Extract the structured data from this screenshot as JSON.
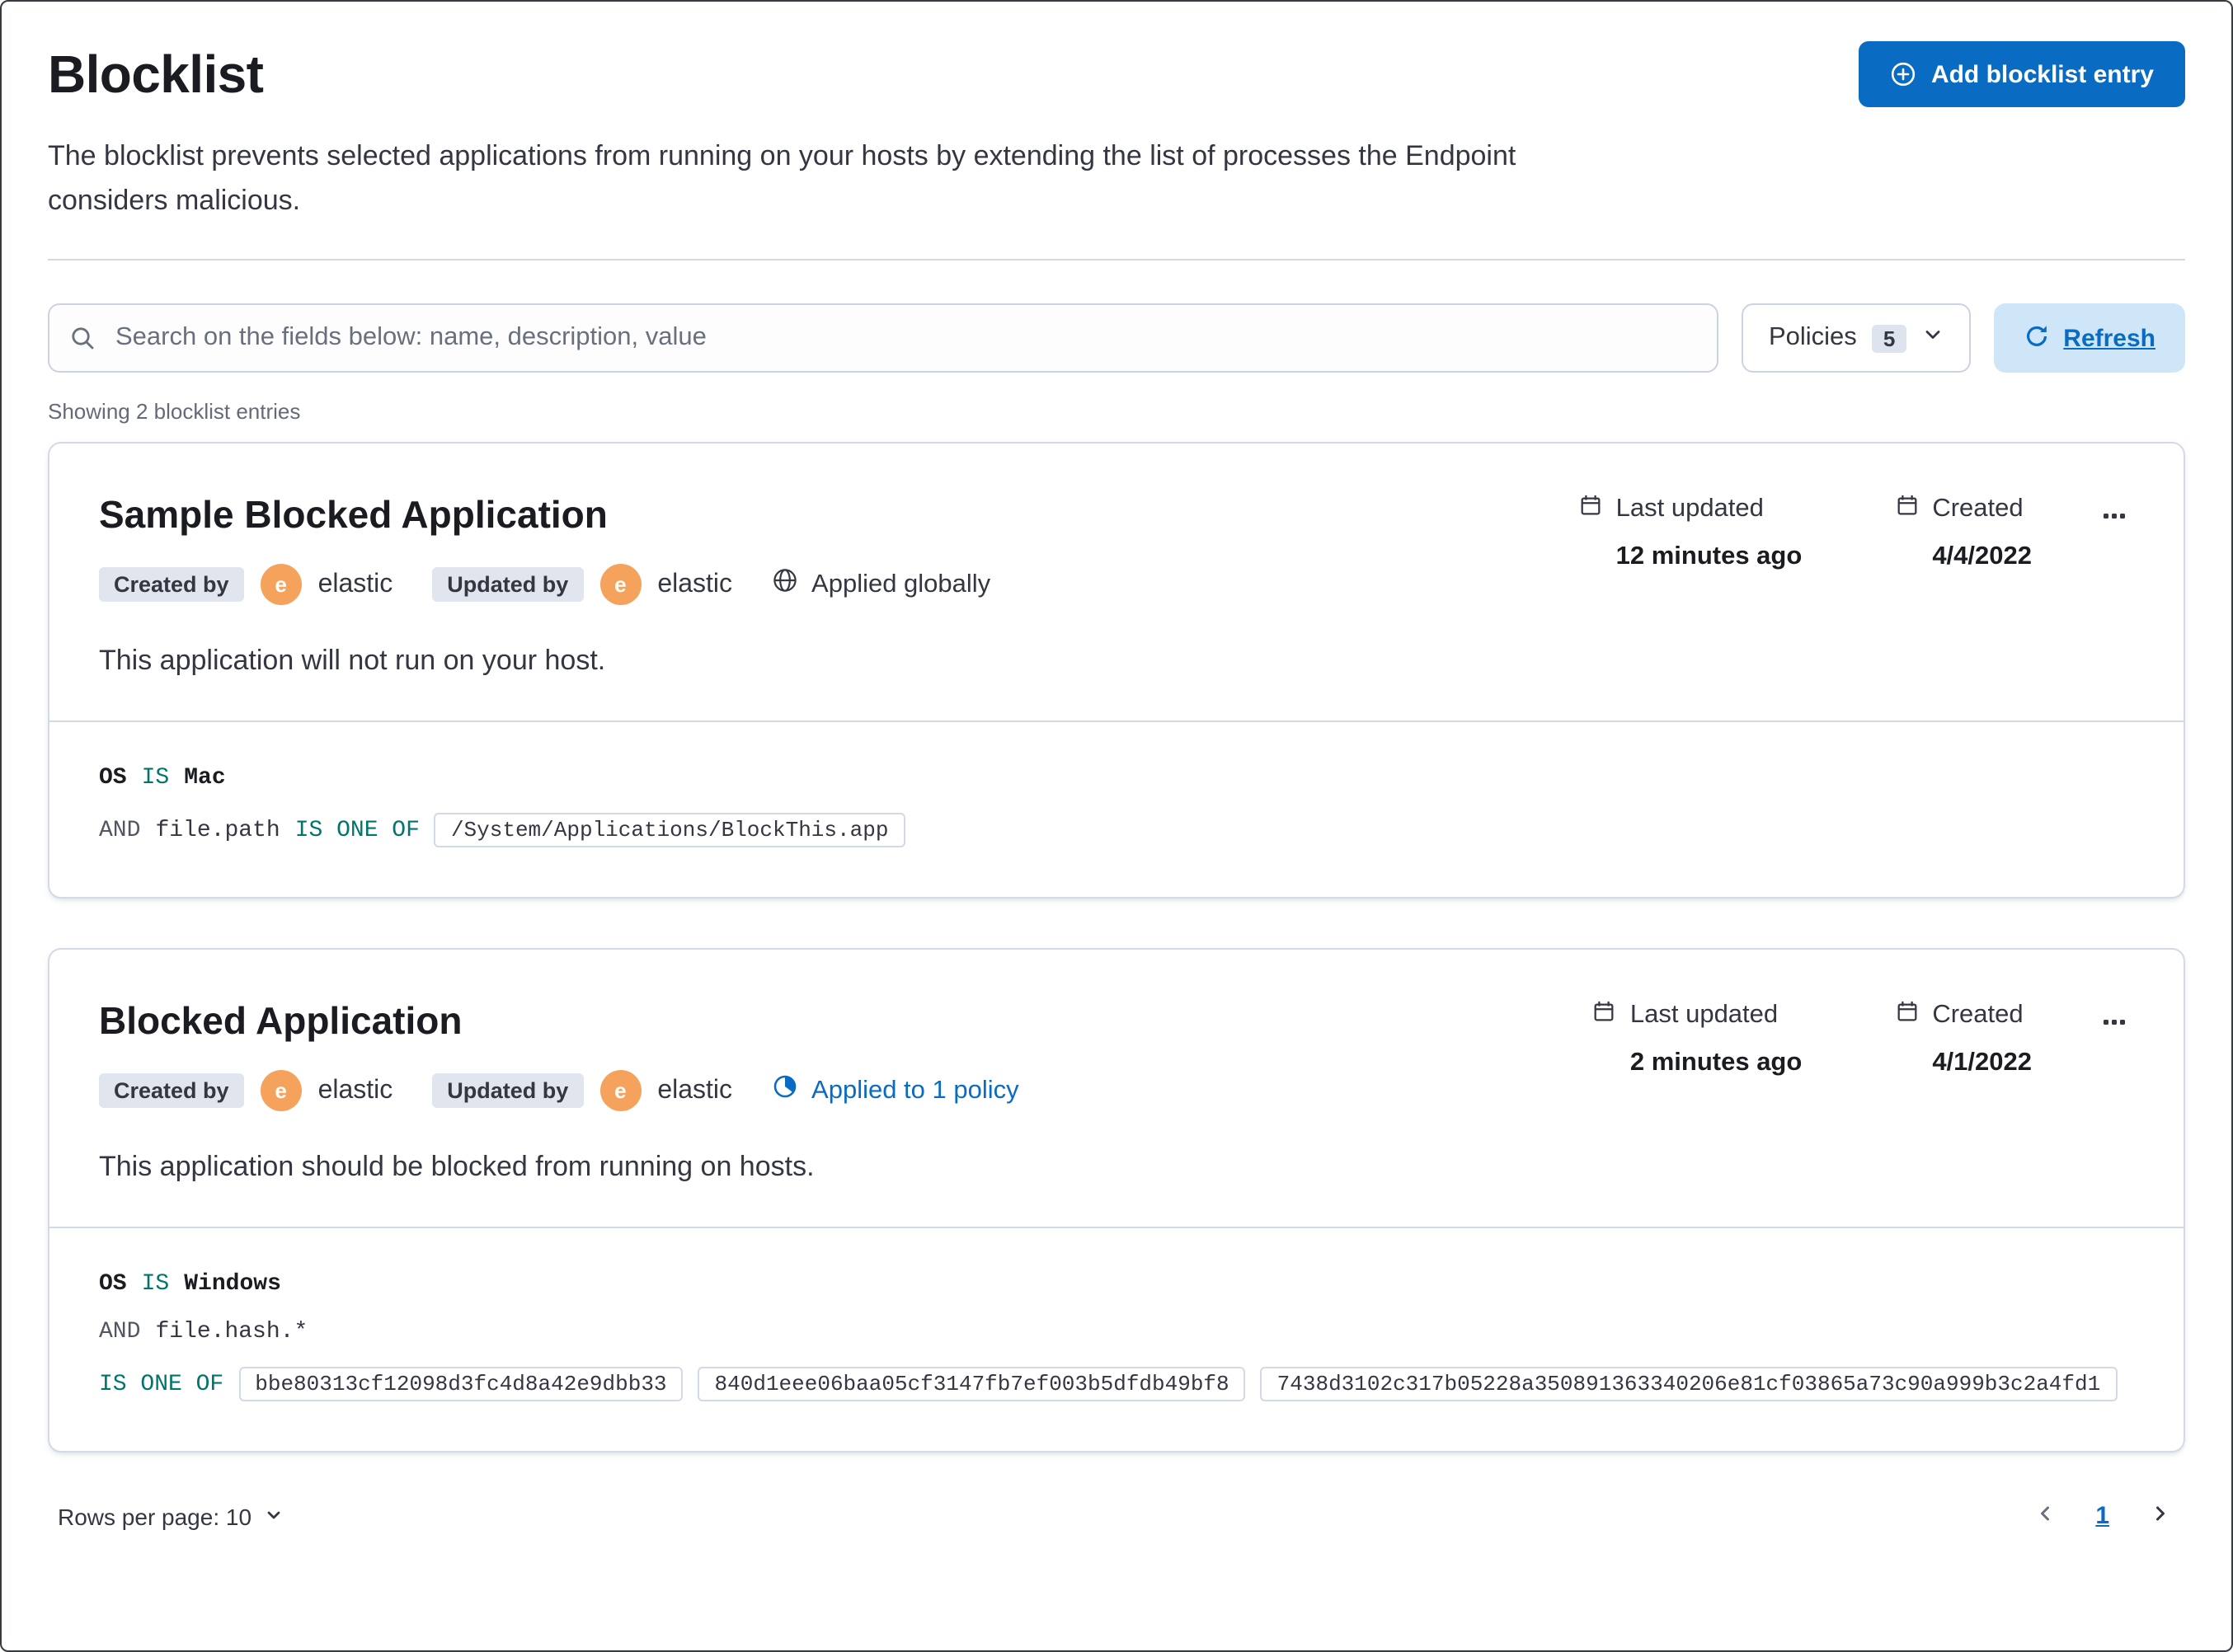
{
  "colors": {
    "primary_blue": "#0a6bc2",
    "operator_teal": "#00756b",
    "avatar_orange": "#f5a35c",
    "border_gray": "#d3dae6",
    "text": "#343741",
    "subdued_text": "#69707d",
    "refresh_button_bg": "#cfe6f8",
    "badge_bg": "#e0e5ee"
  },
  "page": {
    "title": "Blocklist",
    "description": "The blocklist prevents selected applications from running on your hosts by extending the list of processes the Endpoint considers malicious.",
    "add_button_label": "Add blocklist entry",
    "search_placeholder": "Search on the fields below: name, description, value",
    "policies_label": "Policies",
    "policies_count": "5",
    "refresh_label": "Refresh",
    "showing_text": "Showing 2 blocklist entries"
  },
  "entries": [
    {
      "title": "Sample Blocked Application",
      "created_by_label": "Created by",
      "created_by": "elastic",
      "updated_by_label": "Updated by",
      "updated_by": "elastic",
      "avatar_initial": "e",
      "scope_label": "Applied globally",
      "last_updated_label": "Last updated",
      "last_updated_value": "12 minutes ago",
      "created_label": "Created",
      "created_value": "4/4/2022",
      "description": "This application will not run on your host.",
      "criteria": [
        {
          "tokens": [
            {
              "text": "OS",
              "kind": "field"
            },
            {
              "text": "IS",
              "kind": "op"
            },
            {
              "text": "Mac",
              "kind": "value"
            }
          ]
        },
        {
          "tokens": [
            {
              "text": "AND",
              "kind": "conj"
            },
            {
              "text": "file.path",
              "kind": "plain"
            },
            {
              "text": "IS ONE OF",
              "kind": "op"
            },
            {
              "text": "/System/Applications/BlockThis.app",
              "kind": "box"
            }
          ]
        }
      ]
    },
    {
      "title": "Blocked Application",
      "created_by_label": "Created by",
      "created_by": "elastic",
      "updated_by_label": "Updated by",
      "updated_by": "elastic",
      "avatar_initial": "e",
      "scope_label": "Applied to 1 policy",
      "last_updated_label": "Last updated",
      "last_updated_value": "2 minutes ago",
      "created_label": "Created",
      "created_value": "4/1/2022",
      "description": "This application should be blocked from running on hosts.",
      "criteria": [
        {
          "tokens": [
            {
              "text": "OS",
              "kind": "field"
            },
            {
              "text": "IS",
              "kind": "op"
            },
            {
              "text": "Windows",
              "kind": "value"
            }
          ]
        },
        {
          "tokens": [
            {
              "text": "AND",
              "kind": "conj"
            },
            {
              "text": "file.hash.*",
              "kind": "plain"
            }
          ]
        },
        {
          "tokens": [
            {
              "text": "IS ONE OF",
              "kind": "op"
            },
            {
              "text": "bbe80313cf12098d3fc4d8a42e9dbb33",
              "kind": "box"
            },
            {
              "text": "840d1eee06baa05cf3147fb7ef003b5dfdb49bf8",
              "kind": "box"
            },
            {
              "text": "7438d3102c317b05228a350891363340206e81cf03865a73c90a999b3c2a4fd1",
              "kind": "box"
            }
          ]
        }
      ]
    }
  ],
  "footer": {
    "rows_per_page_label": "Rows per page: 10",
    "current_page": "1"
  }
}
